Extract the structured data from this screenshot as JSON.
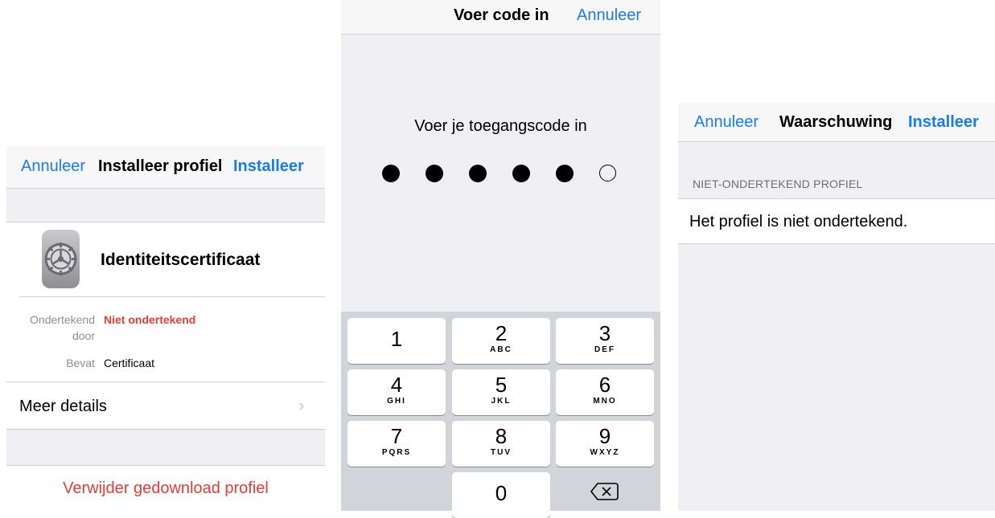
{
  "left": {
    "cancel": "Annuleer",
    "title": "Installeer profiel",
    "install": "Installeer",
    "profile_name": "Identiteitscertificaat",
    "signed_by_label_line1": "Ondertekend",
    "signed_by_label_line2": "door",
    "signed_by_value": "Niet ondertekend",
    "contains_label": "Bevat",
    "contains_value": "Certificaat",
    "more_details": "Meer details",
    "chevron": "›",
    "remove": "Verwijder gedownload profiel",
    "icon": "settings-gear-icon"
  },
  "middle": {
    "title": "Voer code in",
    "cancel": "Annuleer",
    "prompt": "Voer je toegangscode in",
    "code_length": 6,
    "digits_entered": 5,
    "keys": [
      {
        "num": "1",
        "letters": ""
      },
      {
        "num": "2",
        "letters": "ABC"
      },
      {
        "num": "3",
        "letters": "DEF"
      },
      {
        "num": "4",
        "letters": "GHI"
      },
      {
        "num": "5",
        "letters": "JKL"
      },
      {
        "num": "6",
        "letters": "MNO"
      },
      {
        "num": "7",
        "letters": "PQRS"
      },
      {
        "num": "8",
        "letters": "TUV"
      },
      {
        "num": "9",
        "letters": "WXYZ"
      },
      {
        "num": "0",
        "letters": ""
      }
    ],
    "backspace_icon": "backspace-icon"
  },
  "right": {
    "cancel": "Annuleer",
    "title": "Waarschuwing",
    "install": "Installeer",
    "section_header": "NIET-ONDERTEKEND PROFIEL",
    "message": "Het profiel is niet ondertekend."
  }
}
